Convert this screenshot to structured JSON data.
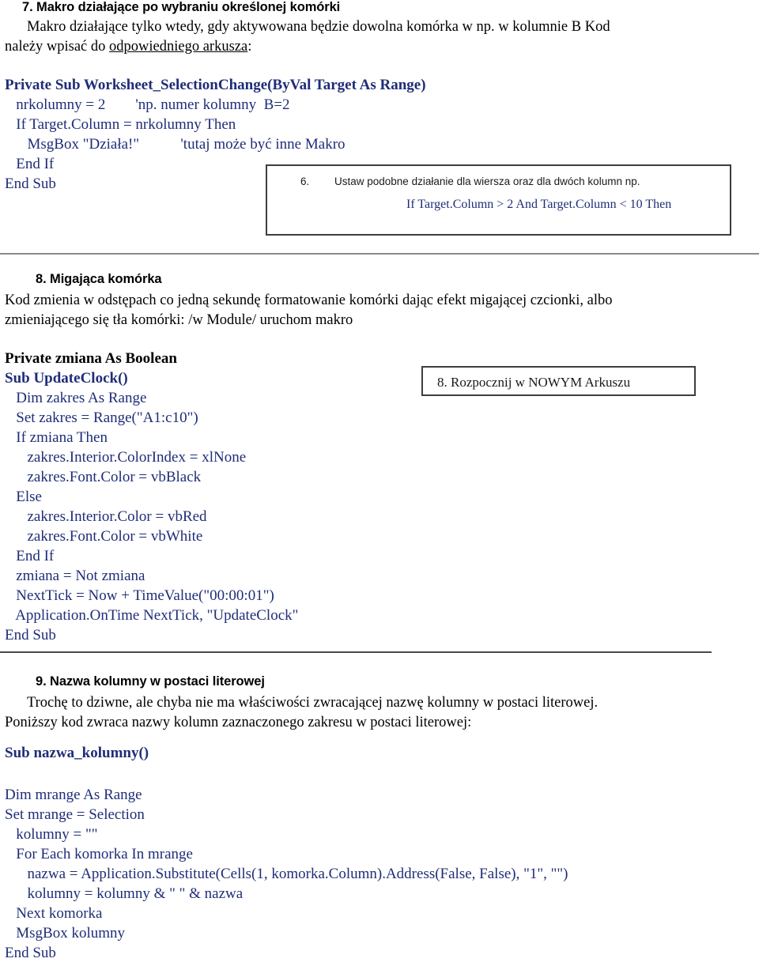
{
  "document": {
    "language": "pl",
    "colors": {
      "code_blue": "#1f2d78",
      "text_black": "#000000",
      "rule_gray": "#8a8a8a",
      "box_border": "#3d3d3d"
    }
  },
  "section7": {
    "heading": "7.  Makro działające po wybraniu określonej komórki",
    "paragraph_line1": "Makro działające tylko wtedy, gdy aktywowana będzie dowolna komórka w np. w kolumnie B  Kod",
    "paragraph_line2_a": "należy wpisać do ",
    "paragraph_line2_underlined": "odpowiedniego arkusza",
    "paragraph_line2_b": ":",
    "code": [
      "Private Sub Worksheet_SelectionChange(ByVal Target As Range)",
      "   nrkolumny = 2        'np. numer kolumny  B=2",
      "   If Target.Column = nrkolumny Then",
      "      MsgBox \"Działa!\"           'tutaj może być inne Makro",
      "   End If",
      "End Sub"
    ]
  },
  "note6": {
    "number": "6.",
    "text": "Ustaw podobne działanie dla wiersza oraz dla dwóch kolumn np.",
    "code": "If Target.Column > 2 And Target.Column < 10 Then"
  },
  "section8": {
    "heading": "8.  Migająca komórka",
    "paragraph_line1": "Kod zmienia w odstępach co jedną sekundę formatowanie komórki dając efekt migającej czcionki, albo",
    "paragraph_line2": "zmieniającego się tła komórki: /w Module/ uruchom makro",
    "code": [
      "Private zmiana As Boolean",
      "Sub UpdateClock()",
      "   Dim zakres As Range",
      "   Set zakres = Range(\"A1:c10\")",
      "   If zmiana Then",
      "      zakres.Interior.ColorIndex = xlNone",
      "      zakres.Font.Color = vbBlack",
      "   Else",
      "      zakres.Interior.Color = vbRed",
      "      zakres.Font.Color = vbWhite",
      "   End If",
      "   zmiana = Not zmiana",
      "   NextTick = Now + TimeValue(\"00:00:01\")",
      "   Application.OnTime NextTick, \"UpdateClock\"",
      "End Sub"
    ]
  },
  "note8": {
    "text": "8. Rozpocznij w NOWYM Arkuszu"
  },
  "section9": {
    "heading": "9.  Nazwa kolumny w postaci literowej",
    "paragraph_line1": "Trochę to dziwne, ale chyba nie ma właściwości zwracającej nazwę kolumny w postaci literowej.",
    "paragraph_line2": "Poniższy kod zwraca nazwy kolumn zaznaczonego zakresu w postaci literowej:",
    "code_title": "Sub nazwa_kolumny()",
    "code": [
      "Dim mrange As Range",
      "Set mrange = Selection",
      "   kolumny = \"\"",
      "   For Each komorka In mrange",
      "      nazwa = Application.Substitute(Cells(1, komorka.Column).Address(False, False), \"1\", \"\")",
      "      kolumny = kolumny & \" \" & nazwa",
      "   Next komorka",
      "   MsgBox kolumny",
      "End Sub"
    ]
  }
}
